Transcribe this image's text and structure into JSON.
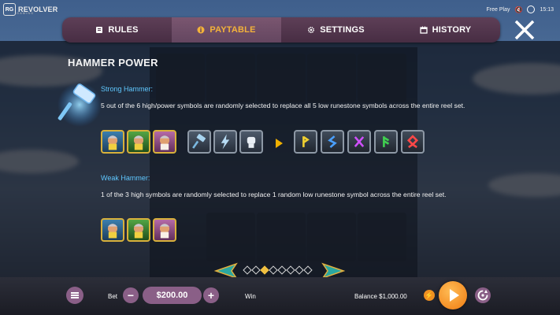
{
  "brand": {
    "name": "REVOLVER",
    "sub": "GAMING",
    "mark": "RG"
  },
  "status": {
    "mode": "Free Play",
    "time": "15:13"
  },
  "nav": {
    "tabs": [
      {
        "label": "RULES",
        "icon": "book-icon"
      },
      {
        "label": "PAYTABLE",
        "icon": "info-icon",
        "active": true
      },
      {
        "label": "SETTINGS",
        "icon": "gear-icon"
      },
      {
        "label": "HISTORY",
        "icon": "calendar-icon"
      }
    ],
    "close_icon": "close-icon"
  },
  "content": {
    "title": "HAMMER POWER",
    "strong": {
      "title": "Strong Hammer:",
      "desc": "5 out of the 6 high/power symbols are randomly selected to replace all 5 low runestone symbols across the entire reel set.",
      "high_symbols": [
        "viking-blue",
        "viking-green",
        "viking-pink"
      ],
      "power_symbols": [
        "hammer-icon",
        "lightning-icon",
        "fist-icon"
      ],
      "runestones": [
        "rune-p",
        "rune-s",
        "rune-x",
        "rune-f",
        "rune-o"
      ]
    },
    "weak": {
      "title": "Weak Hammer:",
      "desc": "1 of the 3 high symbols are randomly selected to replace 1 random low runestone symbol across the entire reel set.",
      "high_symbols": [
        "viking-blue",
        "viking-green",
        "viking-pink"
      ]
    }
  },
  "pager": {
    "pages": 8,
    "current": 2
  },
  "bottom": {
    "bet_label": "Bet",
    "bet_value": "$200.00",
    "minus": "−",
    "plus": "+",
    "win_label": "Win",
    "balance_label": "Balance",
    "balance_value": "$1,000.00"
  },
  "colors": {
    "accent": "#f3b23a",
    "subtitle": "#5fc7ff",
    "panel": "#5e3f57",
    "button": "#8a5f87",
    "spin": "#ef7a10"
  }
}
